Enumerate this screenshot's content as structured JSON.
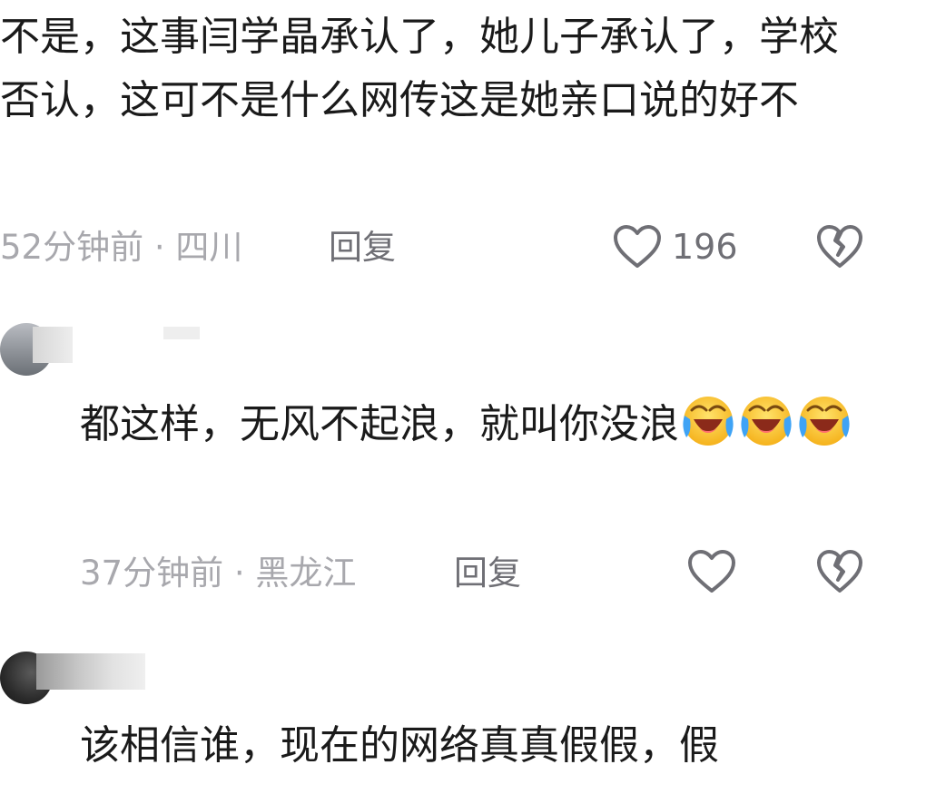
{
  "comments": [
    {
      "text": "不是，这事闫学晶承认了，她儿子承认了，学校否认，这可不是什么网传这是她亲口说的好不",
      "meta": "52分钟前 · 四川",
      "reply_label": "回复",
      "like_count": "196"
    },
    {
      "text": "都这样，无风不起浪，就叫你没浪",
      "emoji_count": 3,
      "emoji_name": "laughing-crying-emoji",
      "meta": "37分钟前 · 黑龙江",
      "reply_label": "回复",
      "like_count": ""
    },
    {
      "text": "该相信谁，现在的网络真真假假，假"
    }
  ],
  "icons": {
    "like": "heart-outline-icon",
    "dislike": "broken-heart-icon"
  },
  "colors": {
    "text": "#1a1a1a",
    "meta": "#a8a8ad",
    "icon": "#6f6f75"
  }
}
